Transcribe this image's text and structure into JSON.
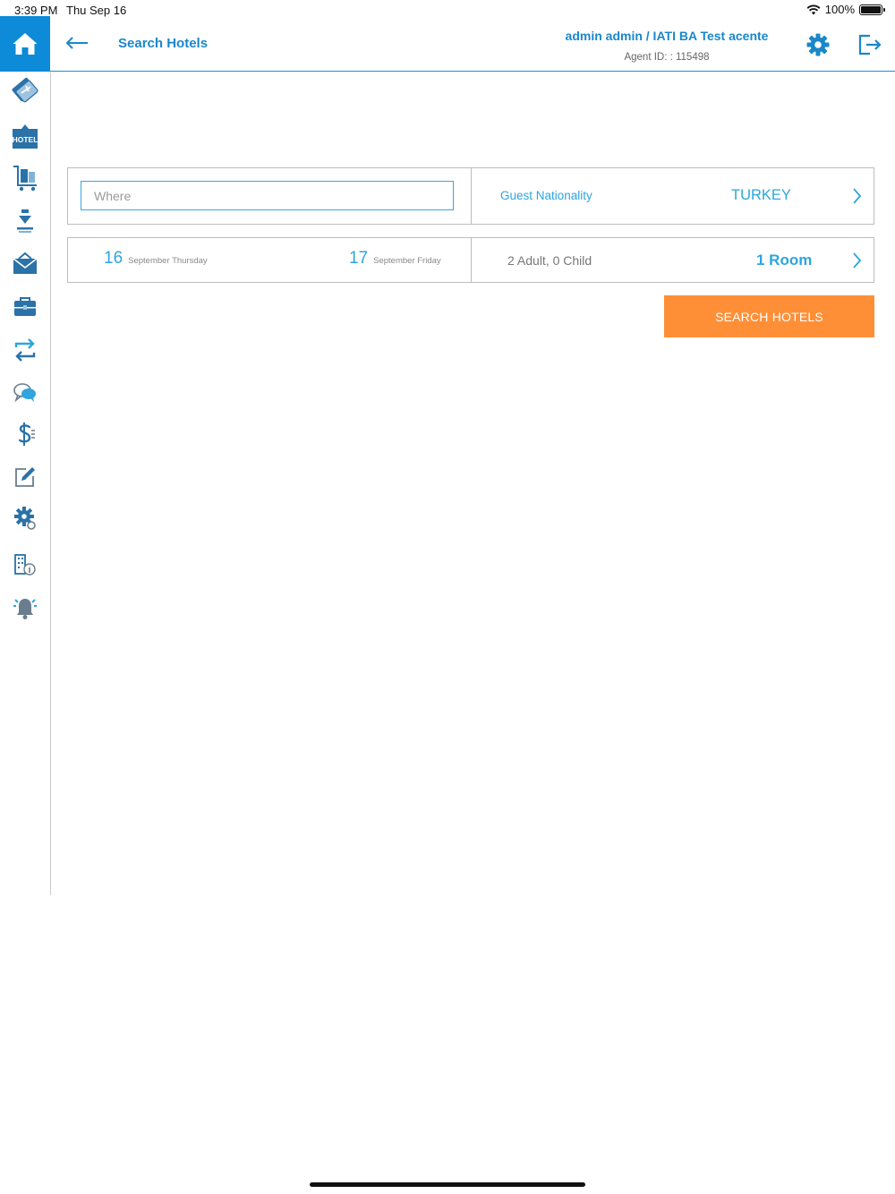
{
  "status": {
    "time": "3:39 PM",
    "date": "Thu Sep 16",
    "battery": "100%"
  },
  "header": {
    "title": "Search Hotels",
    "user": "admin admin / IATI BA Test acente",
    "agent_id": "Agent ID: : 115498"
  },
  "colors": {
    "brand": "#0d8ad8",
    "accent": "#2ea5dc",
    "action": "#ff8f37"
  },
  "sidebar": {
    "items": [
      {
        "icon": "flight-ticket-icon"
      },
      {
        "icon": "hotel-icon",
        "text": "HOTEL"
      },
      {
        "icon": "luggage-cart-icon"
      },
      {
        "icon": "download-icon"
      },
      {
        "icon": "mail-icon"
      },
      {
        "icon": "briefcase-icon"
      },
      {
        "icon": "exchange-icon"
      },
      {
        "icon": "chat-icon"
      },
      {
        "icon": "currency-icon"
      },
      {
        "icon": "edit-icon"
      },
      {
        "icon": "settings-gear-icon"
      },
      {
        "icon": "building-info-icon"
      },
      {
        "icon": "alarm-bell-icon"
      }
    ]
  },
  "search": {
    "where_placeholder": "Where",
    "nationality_label": "Guest Nationality",
    "nationality_value": "TURKEY",
    "checkin": {
      "day": "16",
      "sub": "September Thursday"
    },
    "checkout": {
      "day": "17",
      "sub": "September Friday"
    },
    "guests": "2 Adult, 0 Child",
    "rooms": "1 Room",
    "button": "SEARCH HOTELS"
  }
}
